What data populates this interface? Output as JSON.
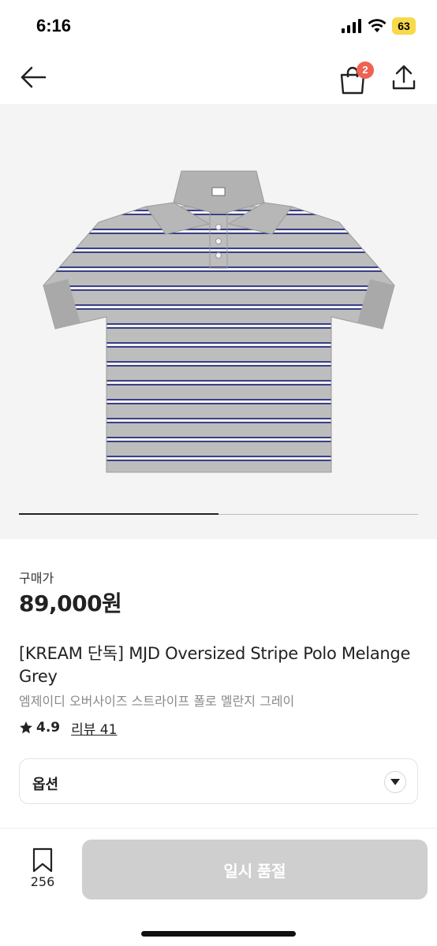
{
  "status_bar": {
    "time": "6:16",
    "battery": "63"
  },
  "nav": {
    "cart_count": "2"
  },
  "gallery": {
    "progress_fraction": 0.5
  },
  "product": {
    "price_label": "구매가",
    "price": "89,000원",
    "title_en": "[KREAM 단독] MJD Oversized Stripe Polo Melange Grey",
    "title_ko": "엠제이디 오버사이즈 스트라이프 폴로 멜란지 그레이",
    "rating": "4.9",
    "review_link": "리뷰 41"
  },
  "option": {
    "label": "옵션"
  },
  "bottom_bar": {
    "bookmark_count": "256",
    "action_label": "일시 품절"
  },
  "colors": {
    "accent_badge": "#ef6253",
    "disabled_button": "#cfcfcf",
    "stripe_navy": "#3a3f87",
    "shirt_grey": "#b8b8b8"
  }
}
